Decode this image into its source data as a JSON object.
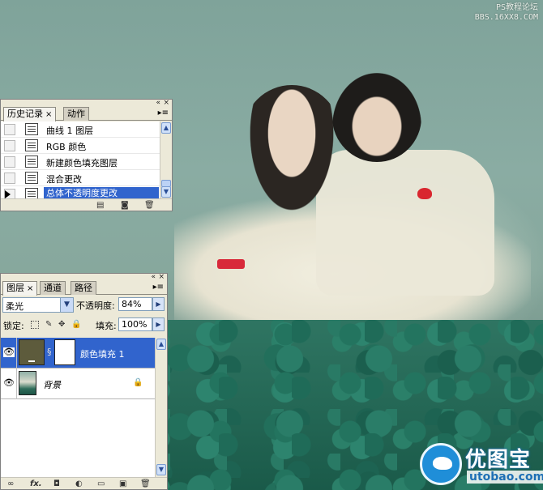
{
  "watermark": {
    "line1": "PS教程论坛",
    "line2": "BBS.16XX8.COM",
    "logo_name": "优图宝",
    "logo_url": "utobao.com"
  },
  "history_panel": {
    "tabs": [
      {
        "label": "历史记录",
        "close": "×",
        "active": true
      },
      {
        "label": "动作",
        "active": false
      }
    ],
    "items": [
      {
        "label": "曲线 1 图层",
        "selected": false
      },
      {
        "label": "RGB 颜色",
        "selected": false
      },
      {
        "label": "新建颜色填充图层",
        "selected": false
      },
      {
        "label": "混合更改",
        "selected": false
      },
      {
        "label": "总体不透明度更改",
        "selected": true
      }
    ],
    "footer_icons": [
      "new-snapshot-icon",
      "camera-icon",
      "trash-icon"
    ]
  },
  "layers_panel": {
    "tabs": [
      {
        "label": "图层",
        "close": "×",
        "active": true
      },
      {
        "label": "通道",
        "active": false
      },
      {
        "label": "路径",
        "active": false
      }
    ],
    "blend_mode": "柔光",
    "opacity_label": "不透明度:",
    "opacity_value": "84%",
    "lock_label": "锁定:",
    "fill_label": "填充:",
    "fill_value": "100%",
    "layers": [
      {
        "name": "颜色填充 1",
        "selected": true,
        "visible": true,
        "type": "fill",
        "fill_color": "#5d5b3c"
      },
      {
        "name": "背景",
        "selected": false,
        "visible": true,
        "type": "background",
        "locked": true
      }
    ],
    "footer_icons": [
      "link-icon",
      "fx-icon",
      "mask-icon",
      "adjustment-icon",
      "folder-icon",
      "new-layer-icon",
      "trash-icon"
    ],
    "fx_label": "fx."
  },
  "colors": {
    "selection": "#3164cd",
    "panel_bg": "#ece9d8"
  }
}
